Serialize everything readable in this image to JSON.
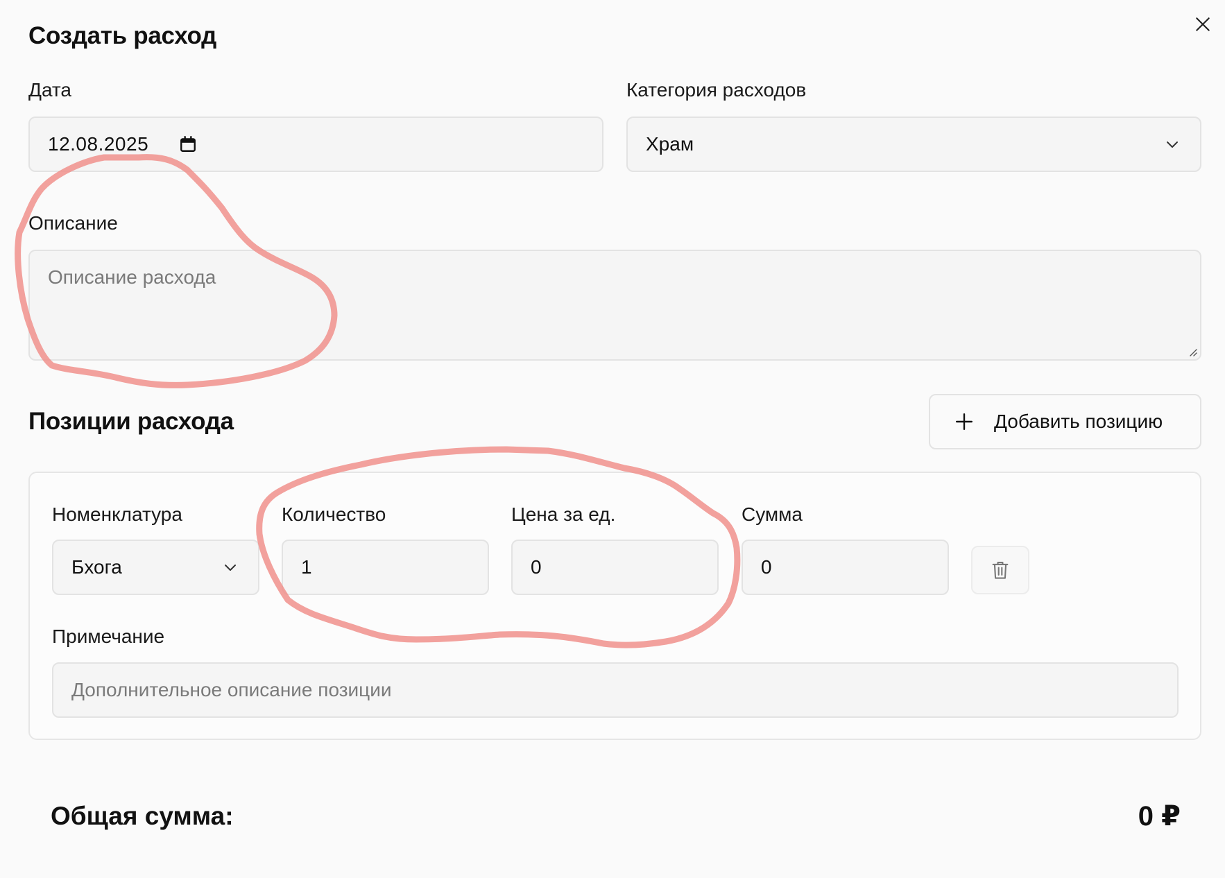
{
  "dialog": {
    "title": "Создать расход",
    "close_icon": "close-icon"
  },
  "date": {
    "label": "Дата",
    "value": "12.08.2025",
    "icon": "calendar-icon"
  },
  "category": {
    "label": "Категория расходов",
    "value": "Храм",
    "icon": "chevron-down-icon"
  },
  "description": {
    "label": "Описание",
    "placeholder": "Описание расхода"
  },
  "positions": {
    "title": "Позиции расхода",
    "add_button_label": "Добавить позицию",
    "add_icon": "plus-icon",
    "items": [
      {
        "nomenclature_label": "Номенклатура",
        "nomenclature_value": "Бхога",
        "quantity_label": "Количество",
        "quantity_value": "1",
        "price_label": "Цена за ед.",
        "price_value": "0",
        "sum_label": "Сумма",
        "sum_value": "0",
        "note_label": "Примечание",
        "note_placeholder": "Дополнительное описание позиции",
        "delete_icon": "trash-icon"
      }
    ]
  },
  "total": {
    "label": "Общая сумма:",
    "value": "0 ₽"
  },
  "colors": {
    "background": "#fafafa",
    "field_background": "#f5f5f5",
    "border": "#e3e3e3",
    "annotation_stroke": "#f0908c"
  }
}
